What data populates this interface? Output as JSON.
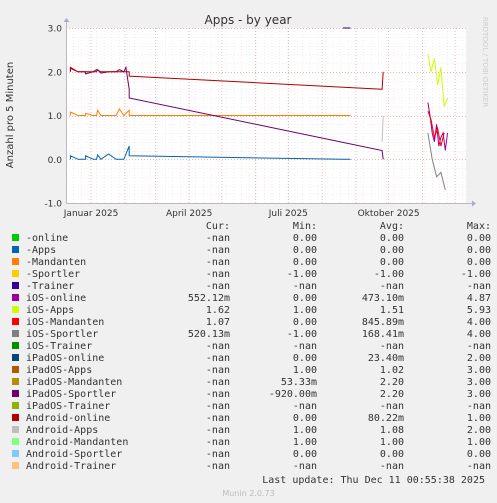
{
  "chart_data": {
    "type": "line",
    "title": "Apps - by year",
    "ylabel": "Anzahl pro 5 Minuten",
    "watermark": "RRDTOOL / TOBI OETIKER",
    "ylim": [
      -1.0,
      3.0
    ],
    "yticks": [
      "3.0",
      "2.0",
      "1.0",
      "0.0",
      "-1.0"
    ],
    "yticks_values": [
      3,
      2,
      1,
      0,
      -1
    ],
    "xlim": [
      "2024-12-09",
      "2025-12-11"
    ],
    "xticks": [
      {
        "label": "Januar 2025",
        "date": "2025-01-01"
      },
      {
        "label": "April 2025",
        "date": "2025-04-01"
      },
      {
        "label": "Juli 2025",
        "date": "2025-07-01"
      },
      {
        "label": "Oktober 2025",
        "date": "2025-10-01"
      }
    ],
    "grid": true,
    "series": [
      {
        "name": "-online",
        "color": "#00cc00",
        "x": [],
        "y": []
      },
      {
        "name": "-Apps",
        "color": "#0066b3",
        "x": [
          "2024-12-13",
          "2024-12-13",
          "2024-12-20",
          "2024-12-27",
          "2024-12-27",
          "2025-01-03",
          "2025-01-06",
          "2025-01-07",
          "2025-01-10",
          "2025-01-17",
          "2025-01-24",
          "2025-01-27",
          "2025-01-31",
          "2025-02-05",
          "2025-02-05",
          "2025-08-20",
          "2025-08-27"
        ],
        "y": [
          0.0,
          0.08,
          0.0,
          0.0,
          0.08,
          0.0,
          0.0,
          0.1,
          0.0,
          0.12,
          0.0,
          0.0,
          0.0,
          0.3,
          0.08,
          0.0,
          0.0
        ]
      },
      {
        "name": "-Mandanten",
        "color": "#ff8000",
        "x": [
          "2024-12-13",
          "2024-12-13",
          "2024-12-20",
          "2024-12-27",
          "2024-12-27",
          "2025-01-03",
          "2025-01-06",
          "2025-01-07",
          "2025-01-10",
          "2025-01-17",
          "2025-01-24",
          "2025-01-27",
          "2025-01-31",
          "2025-02-05",
          "2025-02-05",
          "2025-08-20",
          "2025-08-27"
        ],
        "y": [
          1.0,
          1.08,
          1.0,
          1.0,
          1.05,
          1.0,
          1.0,
          1.12,
          1.0,
          1.0,
          1.0,
          1.15,
          1.0,
          1.12,
          1.0,
          1.0,
          1.0
        ]
      },
      {
        "name": "-Sportler",
        "color": "#ffcc00",
        "x": [],
        "y": []
      },
      {
        "name": "-Trainer",
        "color": "#330099",
        "x": [
          "2025-08-20",
          "2025-08-27"
        ],
        "y": [
          3.0,
          3.0
        ]
      },
      {
        "name": "iOS-online",
        "color": "#990099",
        "x": [
          "2025-11-06",
          "2025-11-08",
          "2025-11-10",
          "2025-11-12",
          "2025-11-14",
          "2025-11-16",
          "2025-11-18",
          "2025-11-20",
          "2025-11-22",
          "2025-11-24"
        ],
        "y": [
          1.3,
          1.0,
          0.6,
          0.4,
          0.8,
          0.3,
          0.5,
          0.6,
          0.2,
          0.6
        ]
      },
      {
        "name": "iOS-Apps",
        "color": "#ccff00",
        "x": [
          "2025-11-06",
          "2025-11-09",
          "2025-11-12",
          "2025-11-15",
          "2025-11-18",
          "2025-11-21",
          "2025-11-24"
        ],
        "y": [
          2.4,
          2.0,
          2.3,
          1.7,
          2.1,
          1.2,
          1.4
        ]
      },
      {
        "name": "iOS-Mandanten",
        "color": "#ff0000",
        "x": [
          "2025-11-06",
          "2025-11-09",
          "2025-11-12",
          "2025-11-15",
          "2025-11-18",
          "2025-11-21"
        ],
        "y": [
          1.1,
          0.9,
          0.5,
          0.7,
          0.3,
          0.6
        ]
      },
      {
        "name": "iOS-Sportler",
        "color": "#808080",
        "x": [
          "2025-11-06",
          "2025-11-10",
          "2025-11-14",
          "2025-11-18",
          "2025-11-22"
        ],
        "y": [
          0.6,
          0.0,
          -0.4,
          -0.3,
          -0.7
        ]
      },
      {
        "name": "iOS-Trainer",
        "color": "#008f00",
        "x": [],
        "y": []
      },
      {
        "name": "iPadOS-online",
        "color": "#00487d",
        "x": [],
        "y": []
      },
      {
        "name": "iPadOS-Apps",
        "color": "#b35a00",
        "x": [],
        "y": []
      },
      {
        "name": "iPadOS-Mandanten",
        "color": "#b38f00",
        "x": [],
        "y": []
      },
      {
        "name": "iPadOS-Sportler",
        "color": "#6b006b",
        "x": [
          "2024-12-13",
          "2024-12-13",
          "2024-12-20",
          "2024-12-27",
          "2024-12-27",
          "2025-01-03",
          "2025-01-06",
          "2025-01-07",
          "2025-01-10",
          "2025-01-17",
          "2025-01-24",
          "2025-01-27",
          "2025-01-31",
          "2025-02-02",
          "2025-02-05",
          "2025-02-05",
          "2025-09-25",
          "2025-09-26"
        ],
        "y": [
          2.0,
          2.08,
          2.0,
          2.0,
          1.95,
          2.0,
          2.0,
          2.05,
          1.97,
          2.0,
          2.0,
          2.05,
          2.0,
          2.1,
          1.6,
          1.4,
          0.2,
          0.0
        ]
      },
      {
        "name": "iPadOS-Trainer",
        "color": "#8fb300",
        "x": [],
        "y": []
      },
      {
        "name": "Android-online",
        "color": "#b30000",
        "x": [
          "2024-12-13",
          "2024-12-13",
          "2024-12-20",
          "2024-12-27",
          "2025-01-03",
          "2025-01-06",
          "2025-01-10",
          "2025-01-17",
          "2025-01-24",
          "2025-01-31",
          "2025-02-05",
          "2025-02-05",
          "2025-09-25",
          "2025-09-26"
        ],
        "y": [
          2.0,
          2.1,
          2.0,
          2.0,
          2.0,
          2.05,
          2.0,
          2.0,
          2.0,
          2.0,
          2.0,
          1.9,
          1.6,
          2.0
        ]
      },
      {
        "name": "Android-Apps",
        "color": "#bebebe",
        "x": [
          "2025-09-25",
          "2025-09-26"
        ],
        "y": [
          0.4,
          1.0
        ]
      },
      {
        "name": "Android-Mandanten",
        "color": "#80ff80",
        "x": [],
        "y": []
      },
      {
        "name": "Android-Sportler",
        "color": "#80c9ff",
        "x": [],
        "y": []
      },
      {
        "name": "Android-Trainer",
        "color": "#ffc080",
        "x": [],
        "y": []
      }
    ]
  },
  "legend": {
    "headers": {
      "cur": "Cur:",
      "min": "Min:",
      "avg": "Avg:",
      "max": "Max:"
    },
    "rows": [
      {
        "label": "-online",
        "color": "#00cc00",
        "cur": "-nan",
        "min": "0.00",
        "avg": "0.00",
        "max": "0.00"
      },
      {
        "label": "-Apps",
        "color": "#0066b3",
        "cur": "-nan",
        "min": "0.00",
        "avg": "0.00",
        "max": "0.00"
      },
      {
        "label": "-Mandanten",
        "color": "#ff8000",
        "cur": "-nan",
        "min": "0.00",
        "avg": "0.00",
        "max": "0.00"
      },
      {
        "label": "-Sportler",
        "color": "#ffcc00",
        "cur": "-nan",
        "min": "-1.00",
        "avg": "-1.00",
        "max": "-1.00"
      },
      {
        "label": "-Trainer",
        "color": "#330099",
        "cur": "-nan",
        "min": "-nan",
        "avg": "-nan",
        "max": "-nan"
      },
      {
        "label": "iOS-online",
        "color": "#990099",
        "cur": "552.12m",
        "min": "0.00",
        "avg": "473.10m",
        "max": "4.87"
      },
      {
        "label": "iOS-Apps",
        "color": "#ccff00",
        "cur": "1.62",
        "min": "1.00",
        "avg": "1.51",
        "max": "5.93"
      },
      {
        "label": "iOS-Mandanten",
        "color": "#ff0000",
        "cur": "1.07",
        "min": "0.00",
        "avg": "845.89m",
        "max": "4.00"
      },
      {
        "label": "iOS-Sportler",
        "color": "#808080",
        "cur": "520.13m",
        "min": "-1.00",
        "avg": "168.41m",
        "max": "4.00"
      },
      {
        "label": "iOS-Trainer",
        "color": "#008f00",
        "cur": "-nan",
        "min": "-nan",
        "avg": "-nan",
        "max": "-nan"
      },
      {
        "label": "iPadOS-online",
        "color": "#00487d",
        "cur": "-nan",
        "min": "0.00",
        "avg": "23.40m",
        "max": "2.00"
      },
      {
        "label": "iPadOS-Apps",
        "color": "#b35a00",
        "cur": "-nan",
        "min": "1.00",
        "avg": "1.02",
        "max": "3.00"
      },
      {
        "label": "iPadOS-Mandanten",
        "color": "#b38f00",
        "cur": "-nan",
        "min": "53.33m",
        "avg": "2.20",
        "max": "3.00"
      },
      {
        "label": "iPadOS-Sportler",
        "color": "#6b006b",
        "cur": "-nan",
        "min": "-920.00m",
        "avg": "2.20",
        "max": "3.00"
      },
      {
        "label": "iPadOS-Trainer",
        "color": "#8fb300",
        "cur": "-nan",
        "min": "-nan",
        "avg": "-nan",
        "max": "-nan"
      },
      {
        "label": "Android-online",
        "color": "#b30000",
        "cur": "-nan",
        "min": "0.00",
        "avg": "80.22m",
        "max": "1.00"
      },
      {
        "label": "Android-Apps",
        "color": "#bebebe",
        "cur": "-nan",
        "min": "1.00",
        "avg": "1.08",
        "max": "2.00"
      },
      {
        "label": "Android-Mandanten",
        "color": "#80ff80",
        "cur": "-nan",
        "min": "1.00",
        "avg": "1.00",
        "max": "1.00"
      },
      {
        "label": "Android-Sportler",
        "color": "#80c9ff",
        "cur": "-nan",
        "min": "0.00",
        "avg": "0.00",
        "max": "0.00"
      },
      {
        "label": "Android-Trainer",
        "color": "#ffc080",
        "cur": "-nan",
        "min": "-nan",
        "avg": "-nan",
        "max": "-nan"
      }
    ]
  },
  "last_update": "Last update: Thu Dec 11 00:55:38 2025",
  "footer": "Munin 2.0.73"
}
